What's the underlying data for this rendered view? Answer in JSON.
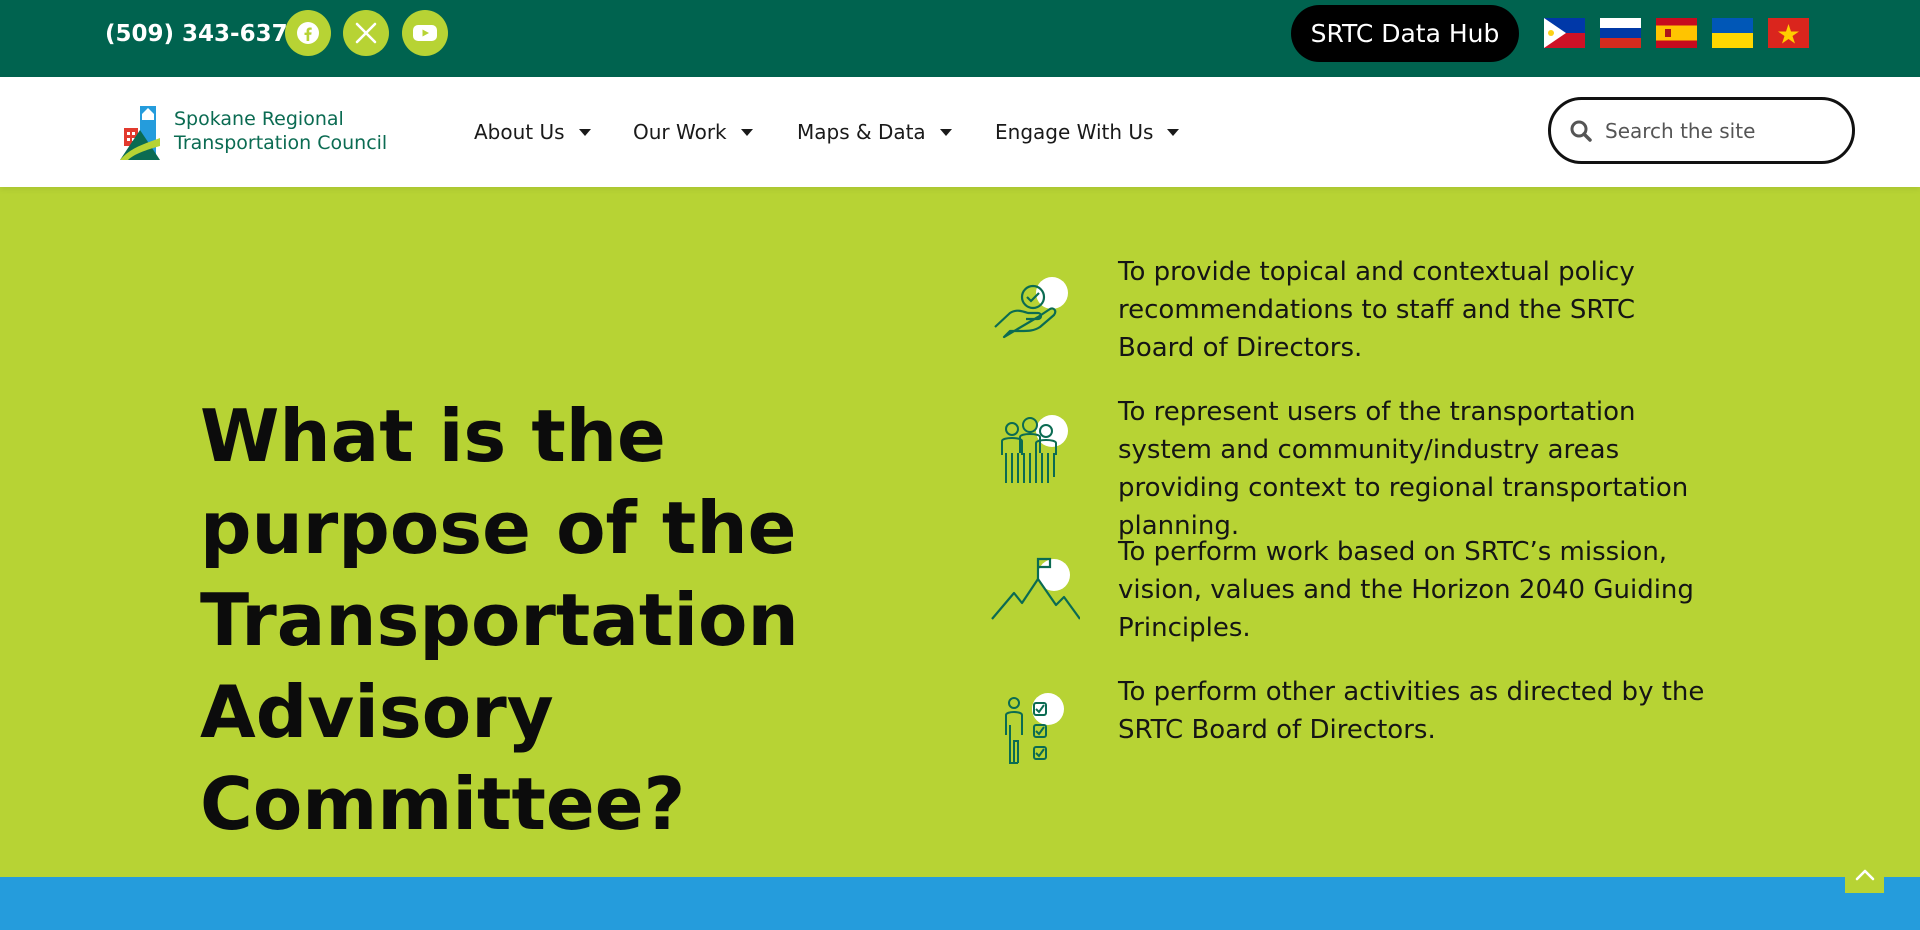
{
  "topbar": {
    "phone": "(509) 343-6370",
    "social": [
      "facebook-icon",
      "x-twitter-icon",
      "youtube-icon"
    ],
    "data_hub": "SRTC Data Hub",
    "flags": [
      "philippines-flag",
      "russia-flag",
      "spain-flag",
      "ukraine-flag",
      "vietnam-flag"
    ]
  },
  "logo": {
    "line1": "Spokane Regional",
    "line2": "Transportation Council"
  },
  "nav": {
    "items": [
      {
        "label": "About Us"
      },
      {
        "label": "Our Work"
      },
      {
        "label": "Maps & Data"
      },
      {
        "label": "Engage With Us"
      }
    ]
  },
  "search": {
    "placeholder": "Search the site"
  },
  "main": {
    "heading": "What is the purpose of the Transportation Advisory Committee?",
    "purposes": [
      {
        "icon": "hand-check-icon",
        "text": "To provide topical and contextual policy recommendations to staff and the SRTC Board of Directors."
      },
      {
        "icon": "people-group-icon",
        "text": "To represent users of the transportation system and community/industry areas providing context to regional transportation planning."
      },
      {
        "icon": "mountain-flag-icon",
        "text": "To perform work based on SRTC’s mission, vision, values and the Horizon 2040 Guiding Principles."
      },
      {
        "icon": "person-checklist-icon",
        "text": "To perform other activities as directed by the SRTC Board of Directors."
      }
    ]
  },
  "colors": {
    "topbar": "#00634f",
    "accent": "#b7d334",
    "footer": "#259cdc",
    "icon_stroke": "#0b6b52"
  }
}
